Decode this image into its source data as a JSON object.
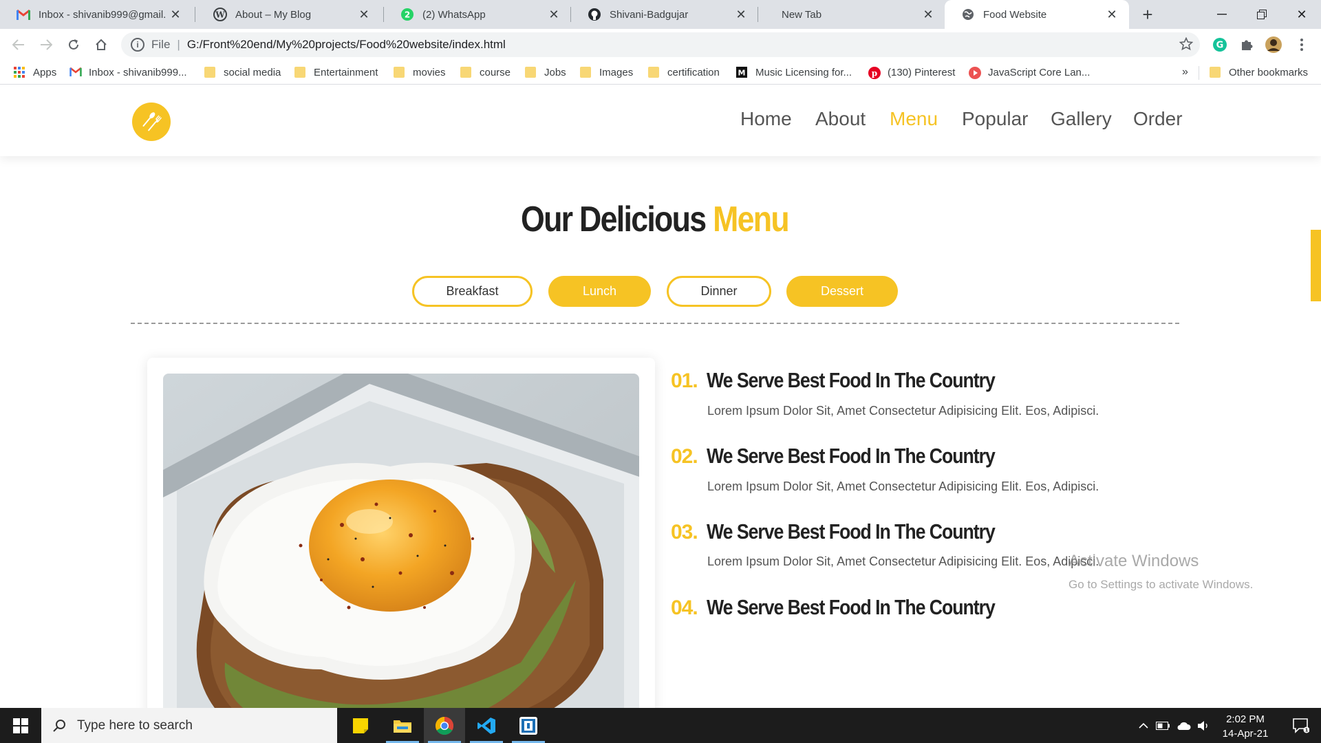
{
  "browser": {
    "tabs": [
      {
        "title": "Inbox - shivanib999@gmail.c",
        "icon": "gmail-icon"
      },
      {
        "title": "About – My Blog",
        "icon": "wordpress-icon"
      },
      {
        "title": "(2) WhatsApp",
        "icon": "whatsapp-icon",
        "badge": "2"
      },
      {
        "title": "Shivani-Badgujar",
        "icon": "github-icon"
      },
      {
        "title": "New Tab",
        "icon": ""
      },
      {
        "title": "Food Website",
        "icon": "globe-icon",
        "active": true
      }
    ],
    "new_tab_label": "+",
    "address": {
      "scheme_label": "File",
      "url": "G:/Front%20end/My%20projects/Food%20website/index.html"
    }
  },
  "bookmarks": {
    "items": [
      {
        "label": "Apps",
        "icon": "apps-grid-icon"
      },
      {
        "label": "Inbox - shivanib999...",
        "icon": "gmail-icon"
      },
      {
        "label": "social media",
        "icon": "folder-icon"
      },
      {
        "label": "Entertainment",
        "icon": "folder-icon"
      },
      {
        "label": "movies",
        "icon": "folder-icon"
      },
      {
        "label": "course",
        "icon": "folder-icon"
      },
      {
        "label": "Jobs",
        "icon": "folder-icon"
      },
      {
        "label": "Images",
        "icon": "folder-icon"
      },
      {
        "label": "certification",
        "icon": "folder-icon"
      },
      {
        "label": "Music Licensing for...",
        "icon": "music-licensing-icon"
      },
      {
        "label": "(130) Pinterest",
        "icon": "pinterest-icon"
      },
      {
        "label": "JavaScript Core Lan...",
        "icon": "javascript-course-icon"
      }
    ],
    "overflow_label": "»",
    "other_bookmarks": "Other bookmarks"
  },
  "site": {
    "nav": [
      {
        "label": "Home",
        "active": false
      },
      {
        "label": "About",
        "active": false
      },
      {
        "label": "Menu",
        "active": true
      },
      {
        "label": "Popular",
        "active": false
      },
      {
        "label": "Gallery",
        "active": false
      },
      {
        "label": "Order",
        "active": false
      }
    ],
    "heading": {
      "main": "Our Delicious ",
      "highlight": "Menu"
    },
    "filters": [
      {
        "label": "Breakfast",
        "style": "outline"
      },
      {
        "label": "Lunch",
        "style": "filled"
      },
      {
        "label": "Dinner",
        "style": "outline"
      },
      {
        "label": "Dessert",
        "style": "filled"
      }
    ],
    "features": [
      {
        "num": "01.",
        "title": "We Serve Best Food In The Country",
        "desc": "Lorem Ipsum Dolor Sit, Amet Consectetur Adipisicing Elit. Eos, Adipisci."
      },
      {
        "num": "02.",
        "title": "We Serve Best Food In The Country",
        "desc": "Lorem Ipsum Dolor Sit, Amet Consectetur Adipisicing Elit. Eos, Adipisci."
      },
      {
        "num": "03.",
        "title": "We Serve Best Food In The Country",
        "desc": "Lorem Ipsum Dolor Sit, Amet Consectetur Adipisicing Elit. Eos, Adipisci."
      },
      {
        "num": "04.",
        "title": "We Serve Best Food In The Country",
        "desc": ""
      }
    ],
    "accent_color": "#f6c324"
  },
  "watermark": {
    "line1": "Activate Windows",
    "line2": "Go to Settings to activate Windows."
  },
  "taskbar": {
    "search_placeholder": "Type here to search",
    "time": "2:02 PM",
    "date": "14-Apr-21"
  }
}
